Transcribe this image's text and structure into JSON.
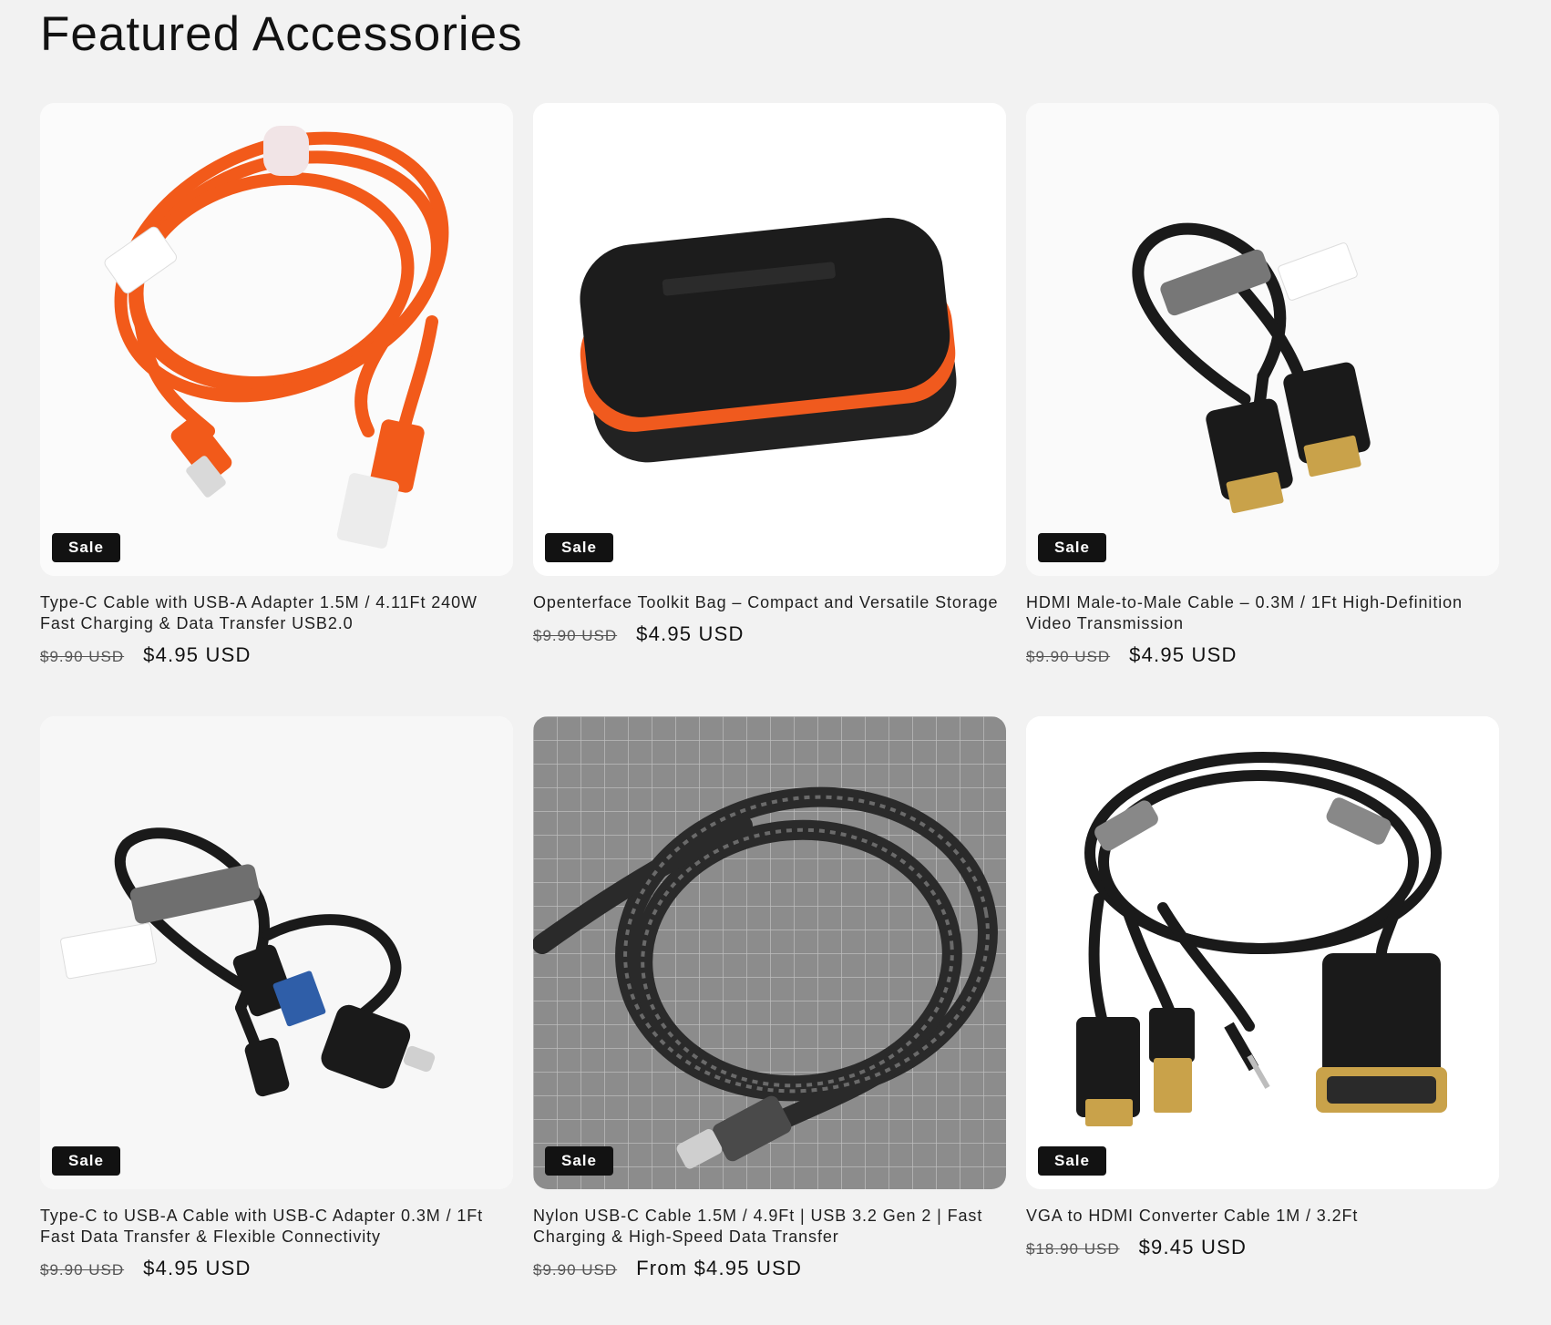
{
  "section": {
    "heading": "Featured Accessories"
  },
  "products": [
    {
      "title": "Type-C Cable with USB-A Adapter 1.5M / 4.11Ft 240W Fast Charging & Data Transfer USB2.0",
      "badge": "Sale",
      "compare_price": "$9.90 USD",
      "price": "$4.95 USD",
      "image": "orange-usb-c-cable"
    },
    {
      "title": "Openterface Toolkit Bag – Compact and Versatile Storage",
      "badge": "Sale",
      "compare_price": "$9.90 USD",
      "price": "$4.95 USD",
      "image": "black-toolkit-bag"
    },
    {
      "title": "HDMI Male-to-Male Cable – 0.3M / 1Ft High-Definition Video Transmission",
      "badge": "Sale",
      "compare_price": "$9.90 USD",
      "price": "$4.95 USD",
      "image": "black-hdmi-cable"
    },
    {
      "title": "Type-C to USB-A Cable with USB-C Adapter 0.3M / 1Ft Fast Data Transfer & Flexible Connectivity",
      "badge": "Sale",
      "compare_price": "$9.90 USD",
      "price": "$4.95 USD",
      "image": "black-usb-c-short-cable"
    },
    {
      "title": "Nylon USB-C Cable 1.5M / 4.9Ft | USB 3.2 Gen 2 | Fast Charging & High-Speed Data Transfer",
      "badge": "Sale",
      "compare_price": "$9.90 USD",
      "price": "From $4.95 USD",
      "image": "braided-nylon-usb-c-cable"
    },
    {
      "title": "VGA to HDMI Converter Cable 1M / 3.2Ft",
      "badge": "Sale",
      "compare_price": "$18.90 USD",
      "price": "$9.45 USD",
      "image": "vga-to-hdmi-cable"
    }
  ],
  "colors": {
    "page_background": "#f2f2f2",
    "badge_background": "#121212",
    "badge_text": "#ffffff",
    "cable_orange": "#f25a1a",
    "cable_black": "#1a1a1a"
  }
}
